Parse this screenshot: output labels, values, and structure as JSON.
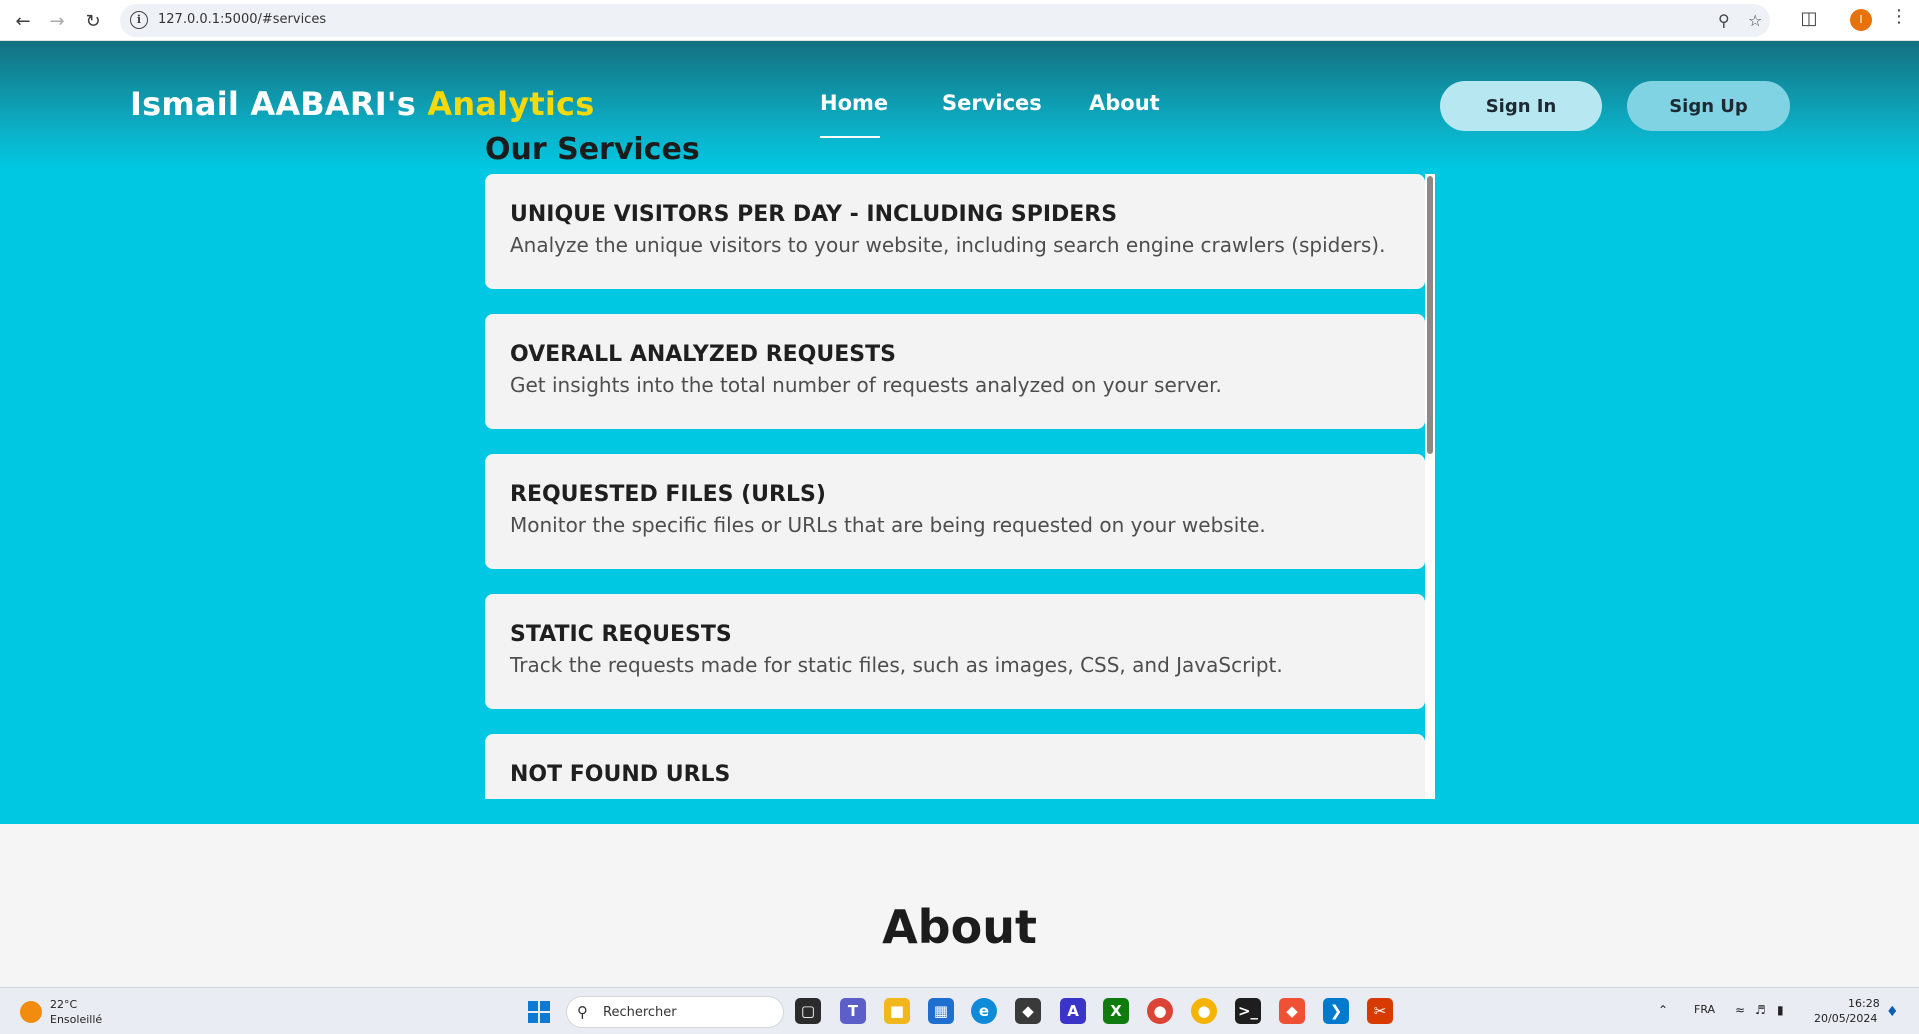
{
  "browser": {
    "url": "127.0.0.1:5000/#services"
  },
  "header": {
    "brand_main": "Ismail AABARI's",
    "brand_accent": "Analytics",
    "nav": [
      "Home",
      "Services",
      "About"
    ],
    "sign_in": "Sign In",
    "sign_up": "Sign Up"
  },
  "services": {
    "title": "Our Services",
    "cards": [
      {
        "title": "UNIQUE VISITORS PER DAY - INCLUDING SPIDERS",
        "desc": "Analyze the unique visitors to your website, including search engine crawlers (spiders)."
      },
      {
        "title": "OVERALL ANALYZED REQUESTS",
        "desc": "Get insights into the total number of requests analyzed on your server."
      },
      {
        "title": "REQUESTED FILES (URLS)",
        "desc": "Monitor the specific files or URLs that are being requested on your website."
      },
      {
        "title": "STATIC REQUESTS",
        "desc": "Track the requests made for static files, such as images, CSS, and JavaScript."
      },
      {
        "title": "NOT FOUND URLS",
        "desc": ""
      }
    ]
  },
  "about": {
    "title": "About"
  },
  "taskbar": {
    "temperature": "22°C",
    "weather": "Ensoleillé",
    "search_placeholder": "Rechercher",
    "language": "FRA",
    "time": "16:28",
    "date": "20/05/2024"
  },
  "colors": {
    "hero": "#00c8e3",
    "accent": "#f5d90a",
    "card": "#f3f3f3"
  }
}
